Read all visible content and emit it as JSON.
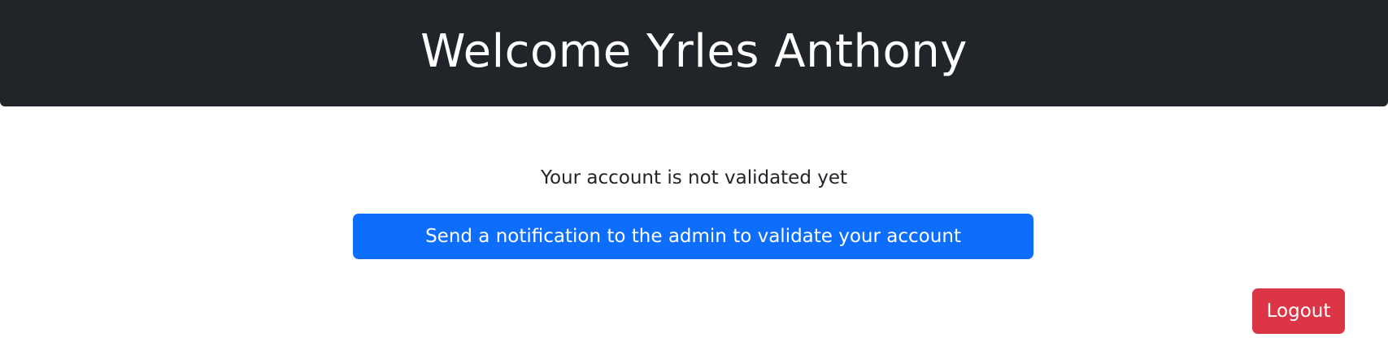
{
  "header": {
    "title": "Welcome Yrles Anthony",
    "background_color": "#212529"
  },
  "main": {
    "status_message": "Your account is not validated yet",
    "notify_button_label": "Send a notification to the admin to validate your account",
    "notify_button_color": "#0d6efd"
  },
  "footer": {
    "logout_label": "Logout",
    "logout_button_color": "#dc3545"
  }
}
